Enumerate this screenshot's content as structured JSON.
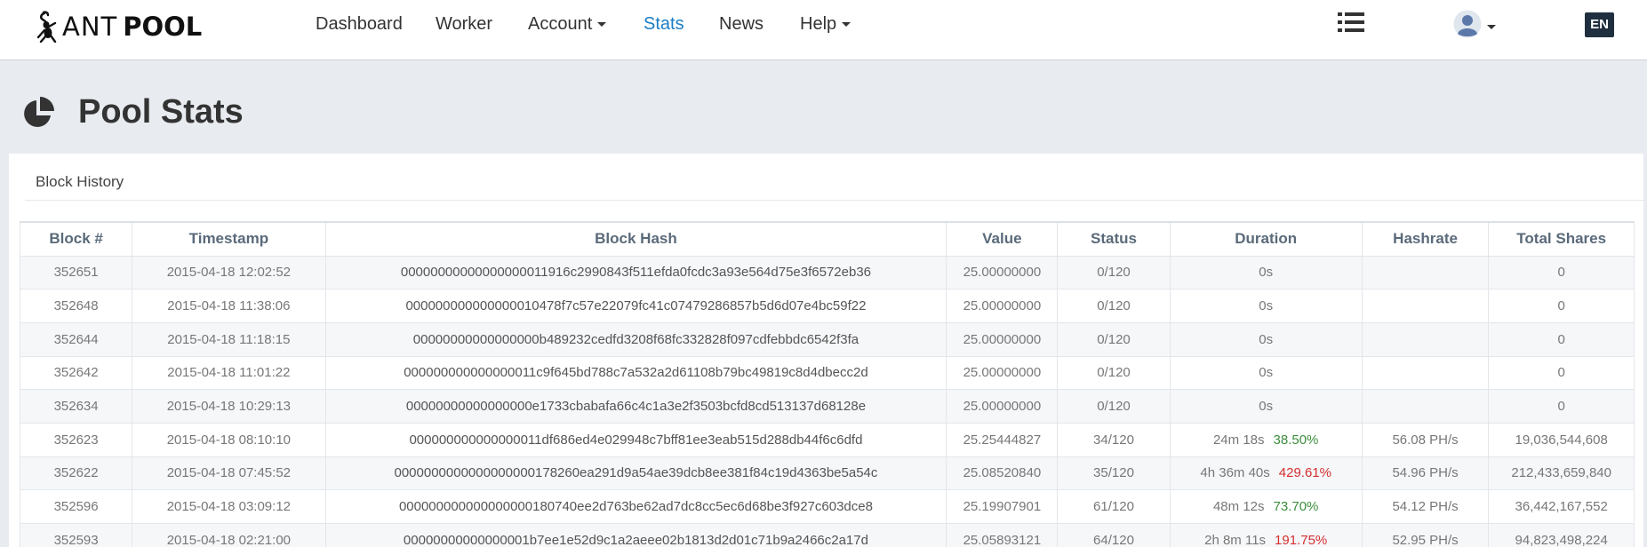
{
  "brand": {
    "part1": "ANT",
    "part2": "POOL"
  },
  "nav": [
    {
      "label": "Dashboard",
      "dropdown": false,
      "active": false
    },
    {
      "label": "Worker",
      "dropdown": false,
      "active": false
    },
    {
      "label": "Account",
      "dropdown": true,
      "active": false
    },
    {
      "label": "Stats",
      "dropdown": false,
      "active": true
    },
    {
      "label": "News",
      "dropdown": false,
      "active": false
    },
    {
      "label": "Help",
      "dropdown": true,
      "active": false
    }
  ],
  "lang": "EN",
  "page": {
    "title": "Pool Stats",
    "icon": "pie-chart-icon"
  },
  "panel": {
    "title": "Block History"
  },
  "table": {
    "headers": [
      "Block #",
      "Timestamp",
      "Block Hash",
      "Value",
      "Status",
      "Duration",
      "Hashrate",
      "Total Shares"
    ],
    "rows": [
      {
        "block": "352651",
        "timestamp": "2015-04-18 12:02:52",
        "hash": "00000000000000000011916c2990843f511efda0fcdc3a93e564d75e3f6572eb36",
        "value": "25.00000000",
        "status": "0/120",
        "duration": "0s",
        "pct": "",
        "pct_state": "",
        "hashrate": "",
        "shares": "0"
      },
      {
        "block": "352648",
        "timestamp": "2015-04-18 11:38:06",
        "hash": "000000000000000010478f7c57e22079fc41c07479286857b5d6d07e4bc59f22",
        "value": "25.00000000",
        "status": "0/120",
        "duration": "0s",
        "pct": "",
        "pct_state": "",
        "hashrate": "",
        "shares": "0"
      },
      {
        "block": "352644",
        "timestamp": "2015-04-18 11:18:15",
        "hash": "00000000000000000b489232cedfd3208f68fc332828f097cdfebbdc6542f3fa",
        "value": "25.00000000",
        "status": "0/120",
        "duration": "0s",
        "pct": "",
        "pct_state": "",
        "hashrate": "",
        "shares": "0"
      },
      {
        "block": "352642",
        "timestamp": "2015-04-18 11:01:22",
        "hash": "000000000000000011c9f645bd788c7a532a2d61108b79bc49819c8d4dbecc2d",
        "value": "25.00000000",
        "status": "0/120",
        "duration": "0s",
        "pct": "",
        "pct_state": "",
        "hashrate": "",
        "shares": "0"
      },
      {
        "block": "352634",
        "timestamp": "2015-04-18 10:29:13",
        "hash": "00000000000000000e1733cbabafa66c4c1a3e2f3503bcfd8cd513137d68128e",
        "value": "25.00000000",
        "status": "0/120",
        "duration": "0s",
        "pct": "",
        "pct_state": "",
        "hashrate": "",
        "shares": "0"
      },
      {
        "block": "352623",
        "timestamp": "2015-04-18 08:10:10",
        "hash": "000000000000000011df686ed4e029948c7bff81ee3eab515d288db44f6c6dfd",
        "value": "25.25444827",
        "status": "34/120",
        "duration": "24m 18s",
        "pct": "38.50%",
        "pct_state": "good",
        "hashrate": "56.08 PH/s",
        "shares": "19,036,544,608"
      },
      {
        "block": "352622",
        "timestamp": "2015-04-18 07:45:52",
        "hash": "0000000000000000000178260ea291d9a54ae39dcb8ee381f84c19d4363be5a54c",
        "value": "25.08520840",
        "status": "35/120",
        "duration": "4h 36m 40s",
        "pct": "429.61%",
        "pct_state": "bad",
        "hashrate": "54.96 PH/s",
        "shares": "212,433,659,840"
      },
      {
        "block": "352596",
        "timestamp": "2015-04-18 03:09:12",
        "hash": "000000000000000000180740ee2d763be62ad7dc8cc5ec6d68be3f927c603dce8",
        "value": "25.19907901",
        "status": "61/120",
        "duration": "48m 12s",
        "pct": "73.70%",
        "pct_state": "good",
        "hashrate": "54.12 PH/s",
        "shares": "36,442,167,552"
      },
      {
        "block": "352593",
        "timestamp": "2015-04-18 02:21:00",
        "hash": "00000000000000001b7ee1e52d9c1a2aeee02b1813d2d01c71b9a2466c2a17d",
        "value": "25.05893121",
        "status": "64/120",
        "duration": "2h 8m 11s",
        "pct": "191.75%",
        "pct_state": "bad",
        "hashrate": "52.95 PH/s",
        "shares": "94,823,498,224"
      }
    ]
  }
}
